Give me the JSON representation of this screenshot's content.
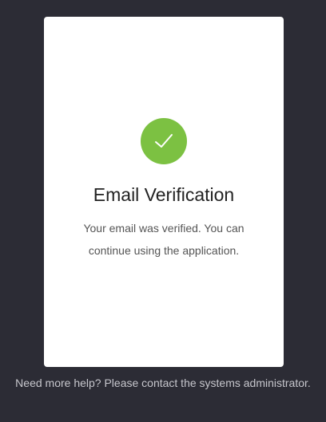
{
  "card": {
    "icon": "check-icon",
    "icon_color": "#7cc142",
    "title": "Email Verification",
    "message": "Your email was verified. You can continue using the application."
  },
  "footer": {
    "help_text": "Need more help? Please contact the systems administrator."
  },
  "colors": {
    "background": "#2c2c35",
    "card": "#ffffff"
  }
}
